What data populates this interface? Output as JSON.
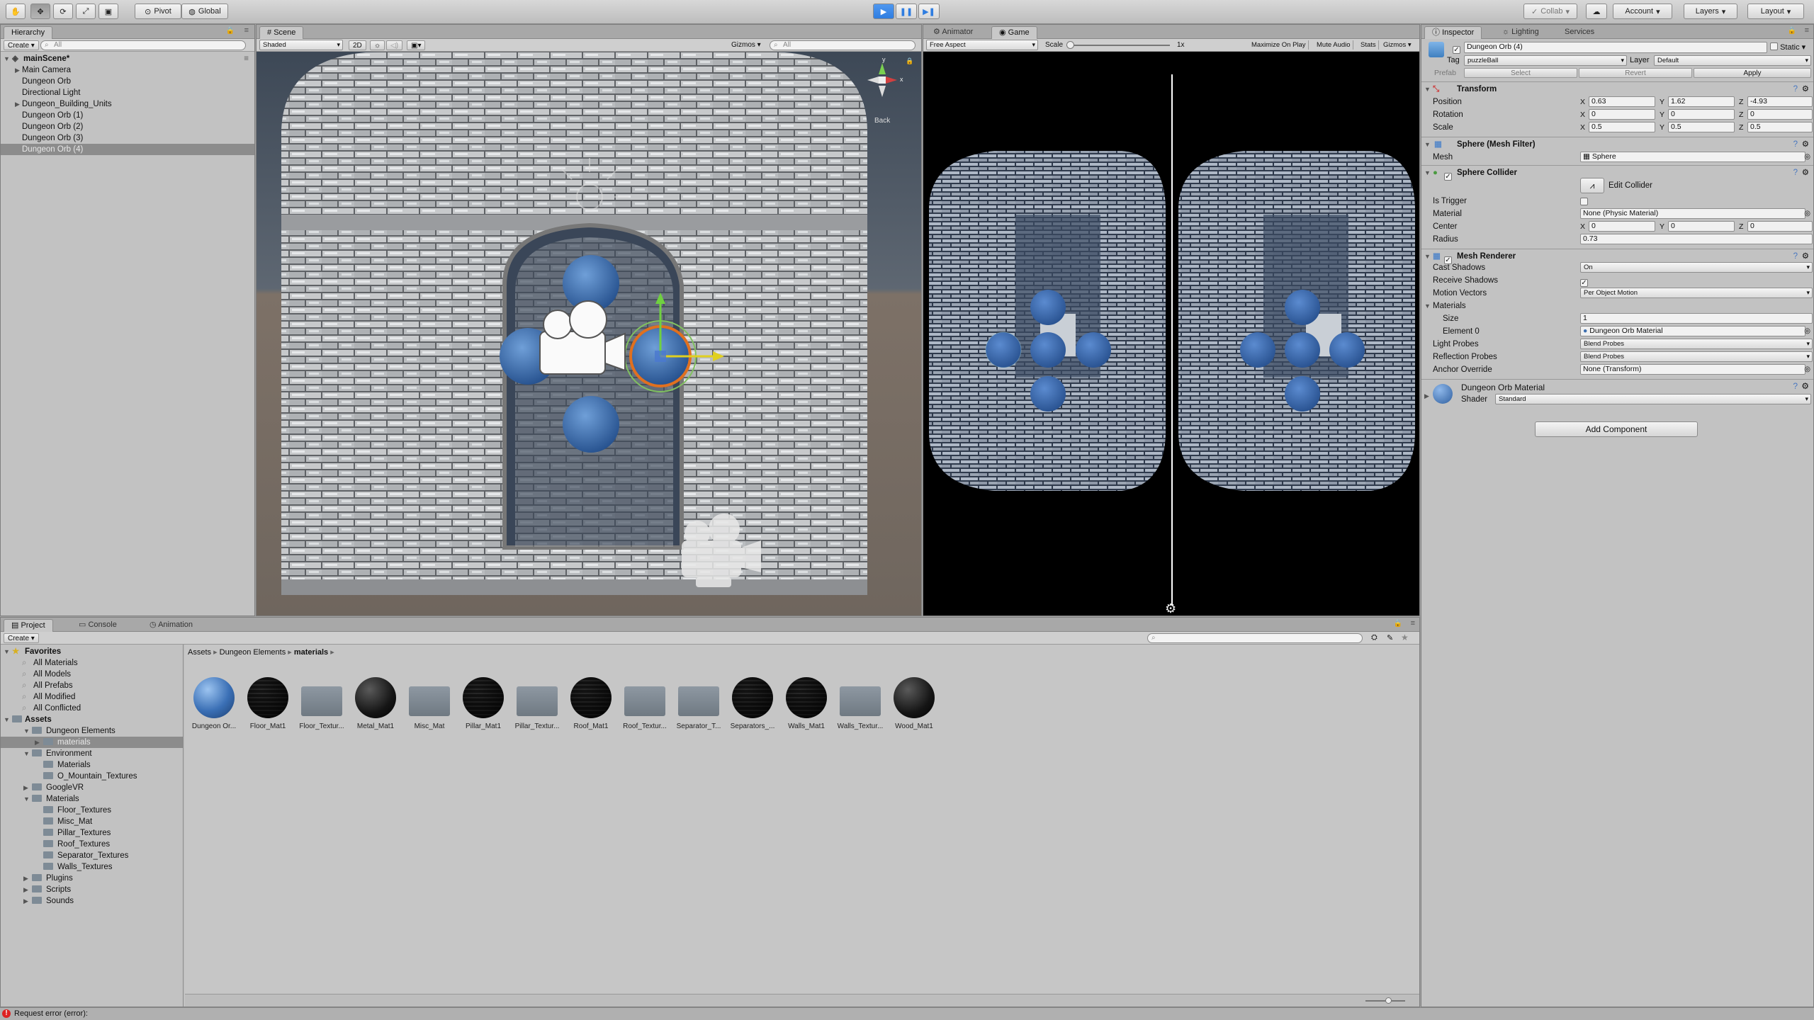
{
  "toolbar": {
    "pivot": "Pivot",
    "global": "Global",
    "collab": "Collab",
    "account": "Account",
    "layers": "Layers",
    "layout": "Layout"
  },
  "hierarchy": {
    "tab": "Hierarchy",
    "create": "Create",
    "search_placeholder": "All",
    "scene": "mainScene*",
    "items": [
      {
        "label": "Main Camera",
        "expandable": true,
        "selected": false
      },
      {
        "label": "Dungeon Orb",
        "expandable": false,
        "selected": false
      },
      {
        "label": "Directional Light",
        "expandable": false,
        "selected": false
      },
      {
        "label": "Dungeon_Building_Units",
        "expandable": true,
        "selected": false
      },
      {
        "label": "Dungeon Orb (1)",
        "expandable": false,
        "selected": false
      },
      {
        "label": "Dungeon Orb (2)",
        "expandable": false,
        "selected": false
      },
      {
        "label": "Dungeon Orb (3)",
        "expandable": false,
        "selected": false
      },
      {
        "label": "Dungeon Orb (4)",
        "expandable": false,
        "selected": true
      }
    ]
  },
  "scene": {
    "tab": "Scene",
    "shading": "Shaded",
    "mode_2d": "2D",
    "gizmos": "Gizmos",
    "search_placeholder": "All",
    "view_label": "Back",
    "axis_x": "x",
    "axis_y": "y"
  },
  "game": {
    "tab_animator": "Animator",
    "tab_game": "Game",
    "aspect": "Free Aspect",
    "scale_label": "Scale",
    "scale_value": "1x",
    "maximize": "Maximize On Play",
    "mute": "Mute Audio",
    "stats": "Stats",
    "gizmos": "Gizmos"
  },
  "inspector": {
    "tab": "Inspector",
    "tab_lighting": "Lighting",
    "tab_services": "Services",
    "object_name": "Dungeon Orb (4)",
    "static_label": "Static",
    "tag_label": "Tag",
    "tag_value": "puzzleBall",
    "layer_label": "Layer",
    "layer_value": "Default",
    "prefab_label": "Prefab",
    "prefab_select": "Select",
    "prefab_revert": "Revert",
    "prefab_apply": "Apply",
    "transform": {
      "title": "Transform",
      "position_label": "Position",
      "position": {
        "x": "0.63",
        "y": "1.62",
        "z": "-4.93"
      },
      "rotation_label": "Rotation",
      "rotation": {
        "x": "0",
        "y": "0",
        "z": "0"
      },
      "scale_label": "Scale",
      "scale": {
        "x": "0.5",
        "y": "0.5",
        "z": "0.5"
      }
    },
    "mesh_filter": {
      "title": "Sphere (Mesh Filter)",
      "mesh_label": "Mesh",
      "mesh_value": "Sphere"
    },
    "collider": {
      "title": "Sphere Collider",
      "edit_collider": "Edit Collider",
      "is_trigger_label": "Is Trigger",
      "material_label": "Material",
      "material_value": "None (Physic Material)",
      "center_label": "Center",
      "center": {
        "x": "0",
        "y": "0",
        "z": "0"
      },
      "radius_label": "Radius",
      "radius_value": "0.73"
    },
    "renderer": {
      "title": "Mesh Renderer",
      "cast_shadows_label": "Cast Shadows",
      "cast_shadows_value": "On",
      "receive_shadows_label": "Receive Shadows",
      "motion_vectors_label": "Motion Vectors",
      "motion_vectors_value": "Per Object Motion",
      "materials_label": "Materials",
      "size_label": "Size",
      "size_value": "1",
      "element0_label": "Element 0",
      "element0_value": "Dungeon Orb Material",
      "light_probes_label": "Light Probes",
      "light_probes_value": "Blend Probes",
      "reflection_probes_label": "Reflection Probes",
      "reflection_probes_value": "Blend Probes",
      "anchor_override_label": "Anchor Override",
      "anchor_override_value": "None (Transform)"
    },
    "material": {
      "title": "Dungeon Orb Material",
      "shader_label": "Shader",
      "shader_value": "Standard"
    },
    "add_component": "Add Component"
  },
  "project": {
    "tab_project": "Project",
    "tab_console": "Console",
    "tab_animation": "Animation",
    "create": "Create",
    "favorites_label": "Favorites",
    "favorites": [
      "All Materials",
      "All Models",
      "All Prefabs",
      "All Modified",
      "All Conflicted"
    ],
    "assets_label": "Assets",
    "tree": [
      {
        "label": "Dungeon Elements",
        "depth": 1,
        "expanded": true,
        "selected": false
      },
      {
        "label": "materials",
        "depth": 2,
        "expanded": false,
        "selected": true
      },
      {
        "label": "Environment",
        "depth": 1,
        "expanded": true,
        "selected": false
      },
      {
        "label": "Materials",
        "depth": 2,
        "expanded": false,
        "selected": false
      },
      {
        "label": "O_Mountain_Textures",
        "depth": 2,
        "expanded": false,
        "selected": false
      },
      {
        "label": "GoogleVR",
        "depth": 1,
        "expanded": false,
        "selected": false
      },
      {
        "label": "Materials",
        "depth": 1,
        "expanded": true,
        "selected": false
      },
      {
        "label": "Floor_Textures",
        "depth": 2,
        "expanded": false,
        "selected": false
      },
      {
        "label": "Misc_Mat",
        "depth": 2,
        "expanded": false,
        "selected": false
      },
      {
        "label": "Pillar_Textures",
        "depth": 2,
        "expanded": false,
        "selected": false
      },
      {
        "label": "Roof_Textures",
        "depth": 2,
        "expanded": false,
        "selected": false
      },
      {
        "label": "Separator_Textures",
        "depth": 2,
        "expanded": false,
        "selected": false
      },
      {
        "label": "Walls_Textures",
        "depth": 2,
        "expanded": false,
        "selected": false
      },
      {
        "label": "Plugins",
        "depth": 1,
        "expanded": false,
        "selected": false
      },
      {
        "label": "Scripts",
        "depth": 1,
        "expanded": false,
        "selected": false
      },
      {
        "label": "Sounds",
        "depth": 1,
        "expanded": false,
        "selected": false
      }
    ],
    "breadcrumb": [
      "Assets",
      "Dungeon Elements",
      "materials"
    ],
    "assets": [
      {
        "label": "Dungeon Or...",
        "kind": "blue-sphere"
      },
      {
        "label": "Floor_Mat1",
        "kind": "texture-sphere"
      },
      {
        "label": "Floor_Textur...",
        "kind": "folder"
      },
      {
        "label": "Metal_Mat1",
        "kind": "dark-sphere"
      },
      {
        "label": "Misc_Mat",
        "kind": "folder"
      },
      {
        "label": "Pillar_Mat1",
        "kind": "texture-sphere"
      },
      {
        "label": "Pillar_Textur...",
        "kind": "folder"
      },
      {
        "label": "Roof_Mat1",
        "kind": "texture-sphere"
      },
      {
        "label": "Roof_Textur...",
        "kind": "folder"
      },
      {
        "label": "Separator_T...",
        "kind": "folder"
      },
      {
        "label": "Separators_...",
        "kind": "texture-sphere"
      },
      {
        "label": "Walls_Mat1",
        "kind": "texture-sphere"
      },
      {
        "label": "Walls_Textur...",
        "kind": "folder"
      },
      {
        "label": "Wood_Mat1",
        "kind": "dark-sphere"
      }
    ]
  },
  "status": {
    "message": "Request error (error):"
  },
  "colors": {
    "play_blue": "#2f7de0",
    "selection": "#8c8c8c",
    "orb": "#3d6fb0"
  }
}
